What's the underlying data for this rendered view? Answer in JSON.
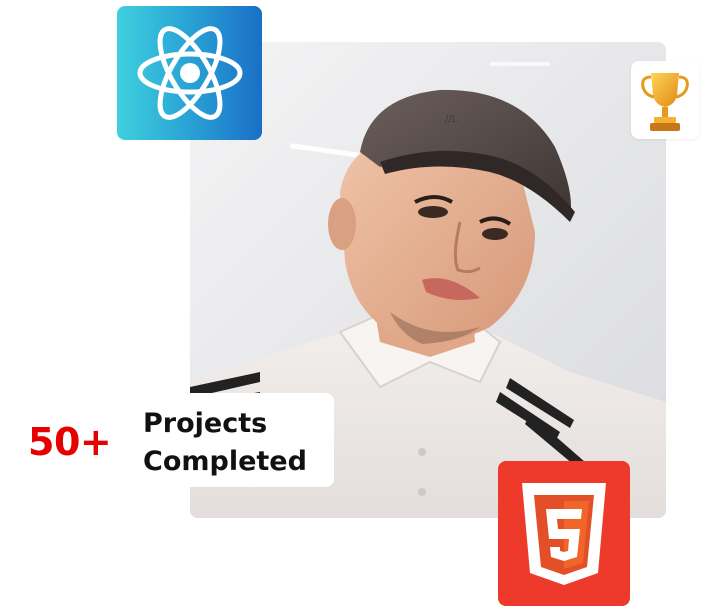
{
  "stats": {
    "count": "50+",
    "label_line1": "Projects",
    "label_line2": "Completed"
  },
  "badges": {
    "react": {
      "icon": "react-logo-icon",
      "colors": [
        "#3fd0de",
        "#1a6fc7"
      ]
    },
    "trophy": {
      "icon": "trophy-icon",
      "color": "#f2a81d"
    },
    "html5": {
      "icon": "html5-logo-icon",
      "color": "#ee3a2a"
    }
  },
  "photo": {
    "icon": "profile-photo"
  },
  "colors": {
    "accent": "#e60000",
    "text": "#111111"
  }
}
